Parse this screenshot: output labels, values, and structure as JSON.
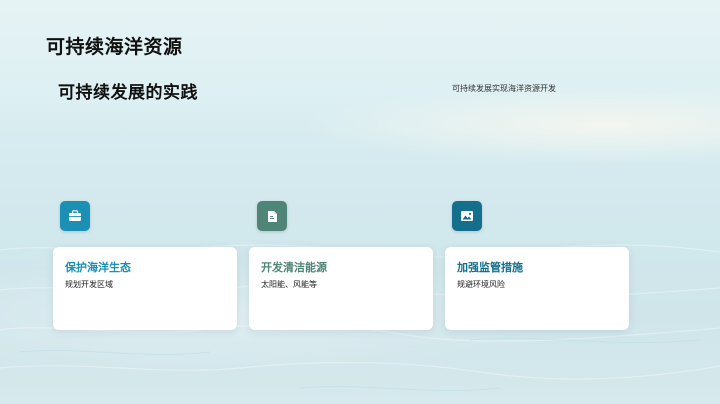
{
  "page": {
    "title": "可持续海洋资源"
  },
  "section": {
    "title": "可持续发展的实践",
    "description": "可持续发展实现海洋资源开发"
  },
  "cards": [
    {
      "icon": "briefcase-icon",
      "icon_color": "#1b8fb4",
      "title": "保护海洋生态",
      "title_color": "#1b8fb4",
      "description": "规划开发区域"
    },
    {
      "icon": "document-icon",
      "icon_color": "#4f8577",
      "title": "开发清洁能源",
      "title_color": "#4f8577",
      "description": "太阳能、风能等"
    },
    {
      "icon": "image-icon",
      "icon_color": "#136f8c",
      "title": "加强监管措施",
      "title_color": "#136f8c",
      "description": "规避环境风险"
    }
  ]
}
